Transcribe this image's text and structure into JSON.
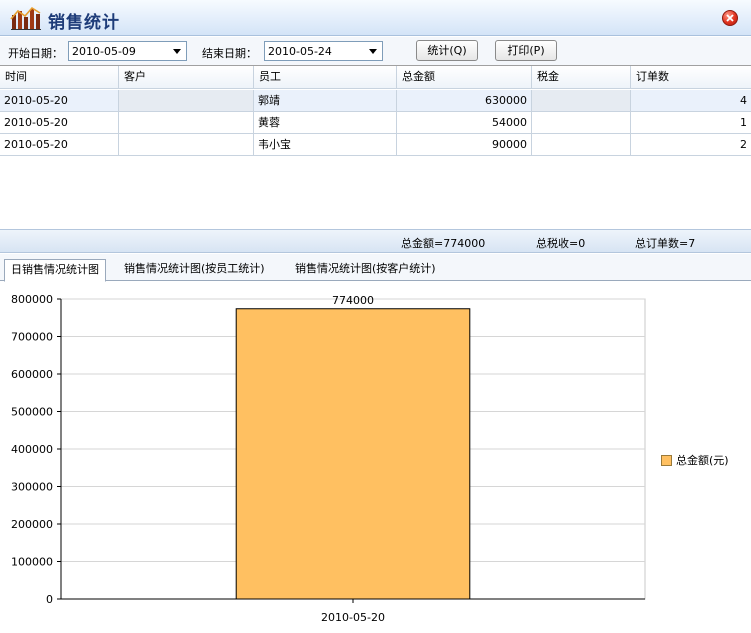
{
  "window": {
    "title": "销售统计",
    "icon": "bar-chart-icon",
    "close_icon": "close-icon"
  },
  "toolbar": {
    "start_label": "开始日期：",
    "start_value": "2010-05-09",
    "end_label": "结束日期：",
    "end_value": "2010-05-24",
    "stat_button": "统计(Q)",
    "print_button": "打印(P)"
  },
  "table": {
    "columns": [
      "时间",
      "客户",
      "员工",
      "总金额",
      "税金",
      "订单数"
    ],
    "rows": [
      {
        "time": "2010-05-20",
        "customer": "",
        "employee": "郭靖",
        "amount": "630000",
        "tax": "",
        "orders": "4"
      },
      {
        "time": "2010-05-20",
        "customer": "",
        "employee": "黄蓉",
        "amount": "54000",
        "tax": "",
        "orders": "1"
      },
      {
        "time": "2010-05-20",
        "customer": "",
        "employee": "韦小宝",
        "amount": "90000",
        "tax": "",
        "orders": "2"
      }
    ],
    "summary": {
      "total_amount": "总金额=774000",
      "total_tax": "总税收=0",
      "total_orders": "总订单数=7"
    }
  },
  "tabs": [
    {
      "label": "日销售情况统计图",
      "active": true
    },
    {
      "label": "销售情况统计图(按员工统计)",
      "active": false
    },
    {
      "label": "销售情况统计图(按客户统计)",
      "active": false
    }
  ],
  "chart_data": {
    "type": "bar",
    "categories": [
      "2010-05-20"
    ],
    "series": [
      {
        "name": "总金额(元)",
        "values": [
          774000
        ]
      }
    ],
    "data_labels": [
      "774000"
    ],
    "yticks": [
      0,
      100000,
      200000,
      300000,
      400000,
      500000,
      600000,
      700000,
      800000
    ],
    "ylim": [
      0,
      800000
    ],
    "grid": true,
    "legend": "right",
    "bar_color": "#ffc061",
    "bar_border": "#000000"
  },
  "colors": {
    "accent": "#1e3c79",
    "selected_row": "#eaf1fb",
    "bar": "#ffc061"
  }
}
